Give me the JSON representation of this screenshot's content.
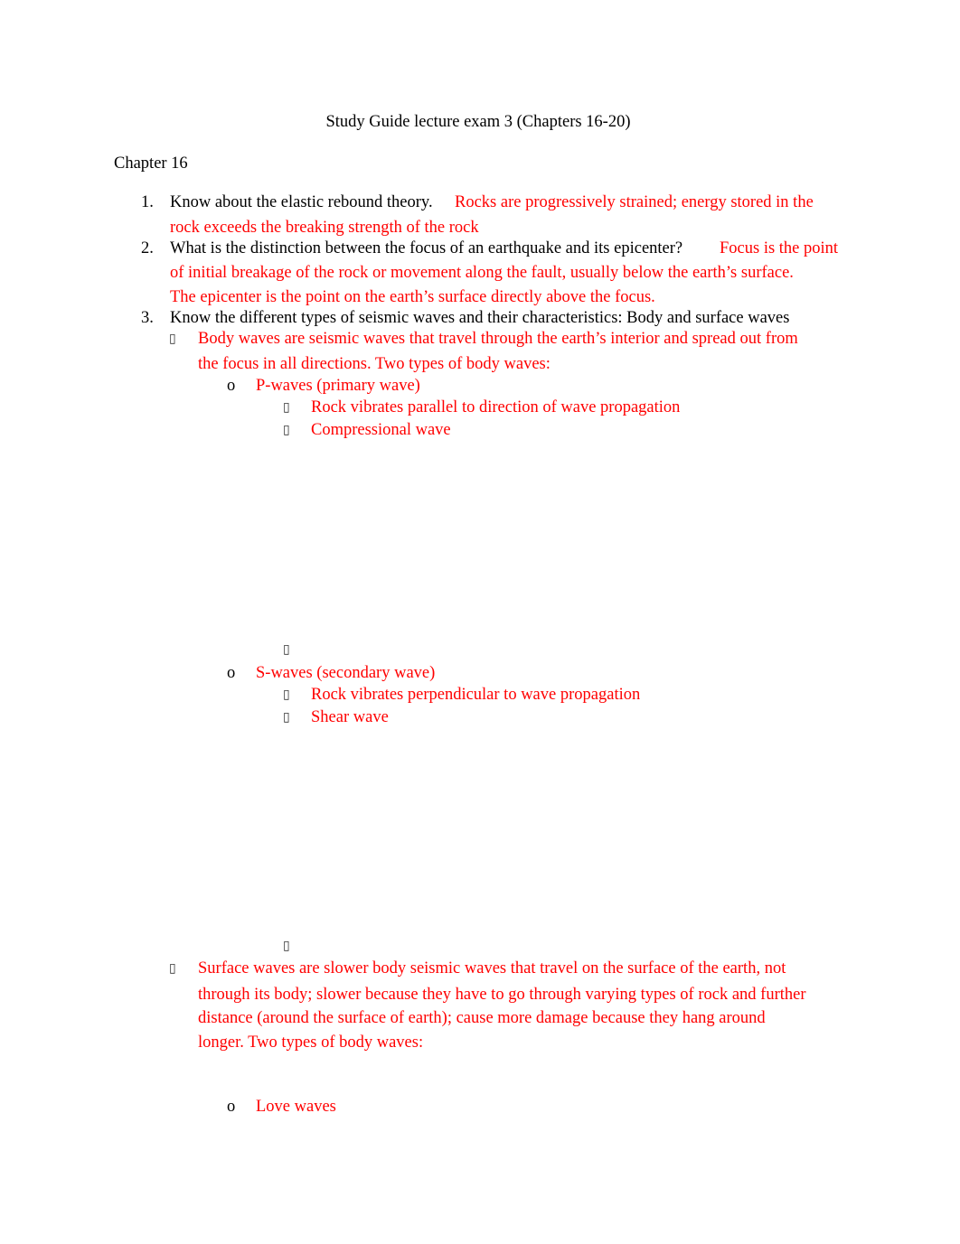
{
  "document": {
    "title": "Study Guide lecture exam 3 (Chapters 16-20)",
    "chapter_heading": "Chapter 16",
    "colors": {
      "answer": "#ff0000",
      "question": "#000000"
    },
    "questions": [
      {
        "number": "1.",
        "question": "Know about the elastic rebound theory.",
        "answer_lines": [
          "Rocks are progressively strained; energy stored in the",
          "rock exceeds the breaking strength of the rock"
        ]
      },
      {
        "number": "2.",
        "question": "What is the distinction between the focus of an earthquake and its epicenter?",
        "answer_lines": [
          "Focus is the point",
          "of initial breakage of the rock or movement along the fault, usually below the earth’s surface.",
          "The epicenter is the point on the earth’s surface directly above the focus."
        ]
      },
      {
        "number": "3.",
        "question": "Know the different types of seismic waves and their characteristics: Body and surface waves",
        "bullets": [
          {
            "bullet_icon": "missing-glyph-box",
            "lines": [
              "Body waves are seismic waves that travel through the earth’s interior and spread out from",
              "the focus in all directions. Two types of body waves:"
            ],
            "subitems": [
              {
                "marker": "o",
                "label": "P-waves (primary wave)",
                "points": [
                  "Rock vibrates parallel to direction of wave propagation",
                  "Compressional wave",
                  ""
                ]
              },
              {
                "marker": "o",
                "label": "S-waves (secondary wave)",
                "points": [
                  "Rock vibrates perpendicular to wave propagation",
                  "Shear wave",
                  ""
                ]
              }
            ]
          },
          {
            "bullet_icon": "missing-glyph-box",
            "lines": [
              "Surface waves are slower body seismic waves that travel on the surface of the earth, not",
              "through its body; slower because they have to go through varying types of rock and further",
              "distance (around the surface of earth); cause more damage because they hang around",
              "longer. Two types of body waves:"
            ],
            "subitems": [
              {
                "marker": "o",
                "label": "Love waves",
                "points": []
              }
            ]
          }
        ]
      }
    ],
    "glyph_box": "▯"
  }
}
